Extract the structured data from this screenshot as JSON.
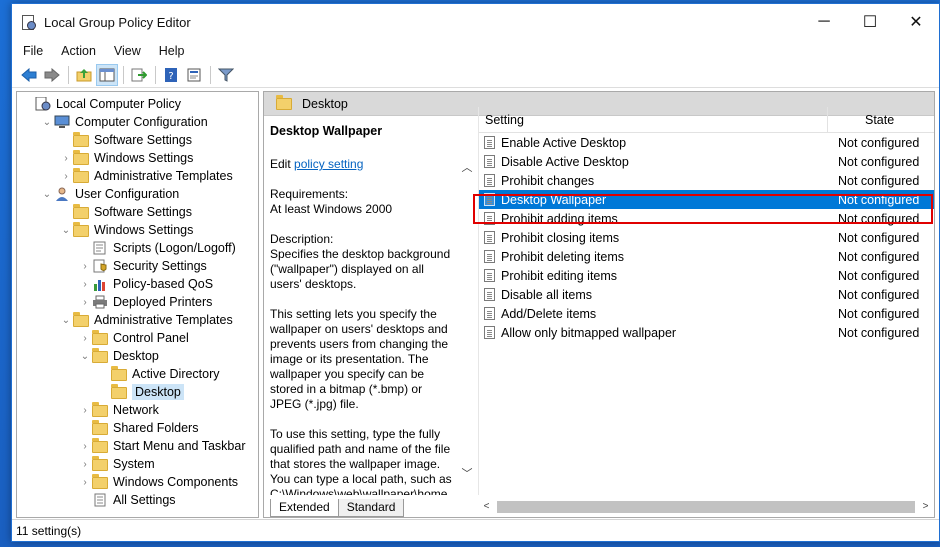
{
  "window": {
    "title": "Local Group Policy Editor",
    "controls": [
      "─",
      "☐",
      "✕"
    ]
  },
  "menu": [
    "File",
    "Action",
    "View",
    "Help"
  ],
  "toolbar_icons": [
    "back-icon",
    "forward-icon",
    "up-folder-icon",
    "show-hide-tree-icon",
    "export-list-icon",
    "help-icon",
    "properties-icon",
    "filter-icon"
  ],
  "tree": [
    {
      "label": "Local Computer Policy",
      "level": 0,
      "chevron": "",
      "icon": "computer-policy-icon"
    },
    {
      "label": "Computer Configuration",
      "level": 1,
      "chevron": "⌄",
      "icon": "computer-icon"
    },
    {
      "label": "Software Settings",
      "level": 2,
      "chevron": "",
      "icon": "folder-icon"
    },
    {
      "label": "Windows Settings",
      "level": 2,
      "chevron": "›",
      "icon": "folder-icon"
    },
    {
      "label": "Administrative Templates",
      "level": 2,
      "chevron": "›",
      "icon": "folder-icon"
    },
    {
      "label": "User Configuration",
      "level": 1,
      "chevron": "⌄",
      "icon": "user-icon"
    },
    {
      "label": "Software Settings",
      "level": 2,
      "chevron": "",
      "icon": "folder-icon"
    },
    {
      "label": "Windows Settings",
      "level": 2,
      "chevron": "⌄",
      "icon": "folder-icon"
    },
    {
      "label": "Scripts (Logon/Logoff)",
      "level": 3,
      "chevron": "",
      "icon": "scripts-icon"
    },
    {
      "label": "Security Settings",
      "level": 3,
      "chevron": "›",
      "icon": "security-icon"
    },
    {
      "label": "Policy-based QoS",
      "level": 3,
      "chevron": "›",
      "icon": "qos-chart-icon"
    },
    {
      "label": "Deployed Printers",
      "level": 3,
      "chevron": "›",
      "icon": "printer-icon"
    },
    {
      "label": "Administrative Templates",
      "level": 2,
      "chevron": "⌄",
      "icon": "folder-icon"
    },
    {
      "label": "Control Panel",
      "level": 3,
      "chevron": "›",
      "icon": "folder-icon"
    },
    {
      "label": "Desktop",
      "level": 3,
      "chevron": "⌄",
      "icon": "folder-icon"
    },
    {
      "label": "Active Directory",
      "level": 4,
      "chevron": "",
      "icon": "folder-icon"
    },
    {
      "label": "Desktop",
      "level": 4,
      "chevron": "",
      "icon": "folder-open-icon",
      "selected": true
    },
    {
      "label": "Network",
      "level": 3,
      "chevron": "›",
      "icon": "folder-icon"
    },
    {
      "label": "Shared Folders",
      "level": 3,
      "chevron": "",
      "icon": "folder-icon"
    },
    {
      "label": "Start Menu and Taskbar",
      "level": 3,
      "chevron": "›",
      "icon": "folder-icon"
    },
    {
      "label": "System",
      "level": 3,
      "chevron": "›",
      "icon": "folder-icon"
    },
    {
      "label": "Windows Components",
      "level": 3,
      "chevron": "›",
      "icon": "folder-icon"
    },
    {
      "label": "All Settings",
      "level": 3,
      "chevron": "",
      "icon": "all-settings-icon"
    }
  ],
  "right": {
    "header": "Desktop",
    "description": {
      "title": "Desktop Wallpaper",
      "edit_prefix": "Edit ",
      "edit_link": "policy setting",
      "requirements_label": "Requirements:",
      "requirements_value": "At least Windows 2000",
      "description_label": "Description:",
      "para1": "Specifies the desktop background (\"wallpaper\") displayed on all users' desktops.",
      "para2": "This setting lets you specify the wallpaper on users' desktops and prevents users from changing the image or its presentation. The wallpaper you specify can be stored in a bitmap (*.bmp) or JPEG (*.jpg) file.",
      "para3": "To use this setting, type the fully qualified path and name of the file that stores the wallpaper image. You can type a local path, such as C:\\Windows\\web\\wallpaper\\home"
    },
    "columns": {
      "setting": "Setting",
      "state": "State"
    },
    "rows": [
      {
        "name": "Enable Active Desktop",
        "state": "Not configured"
      },
      {
        "name": "Disable Active Desktop",
        "state": "Not configured"
      },
      {
        "name": "Prohibit changes",
        "state": "Not configured"
      },
      {
        "name": "Desktop Wallpaper",
        "state": "Not configured",
        "selected": true
      },
      {
        "name": "Prohibit adding items",
        "state": "Not configured"
      },
      {
        "name": "Prohibit closing items",
        "state": "Not configured"
      },
      {
        "name": "Prohibit deleting items",
        "state": "Not configured"
      },
      {
        "name": "Prohibit editing items",
        "state": "Not configured"
      },
      {
        "name": "Disable all items",
        "state": "Not configured"
      },
      {
        "name": "Add/Delete items",
        "state": "Not configured"
      },
      {
        "name": "Allow only bitmapped wallpaper",
        "state": "Not configured"
      }
    ],
    "tabs": [
      "Extended",
      "Standard"
    ]
  },
  "status": "11 setting(s)",
  "colors": {
    "selection": "#0078d7",
    "highlight_box": "#e00000",
    "link": "#0563c1"
  }
}
